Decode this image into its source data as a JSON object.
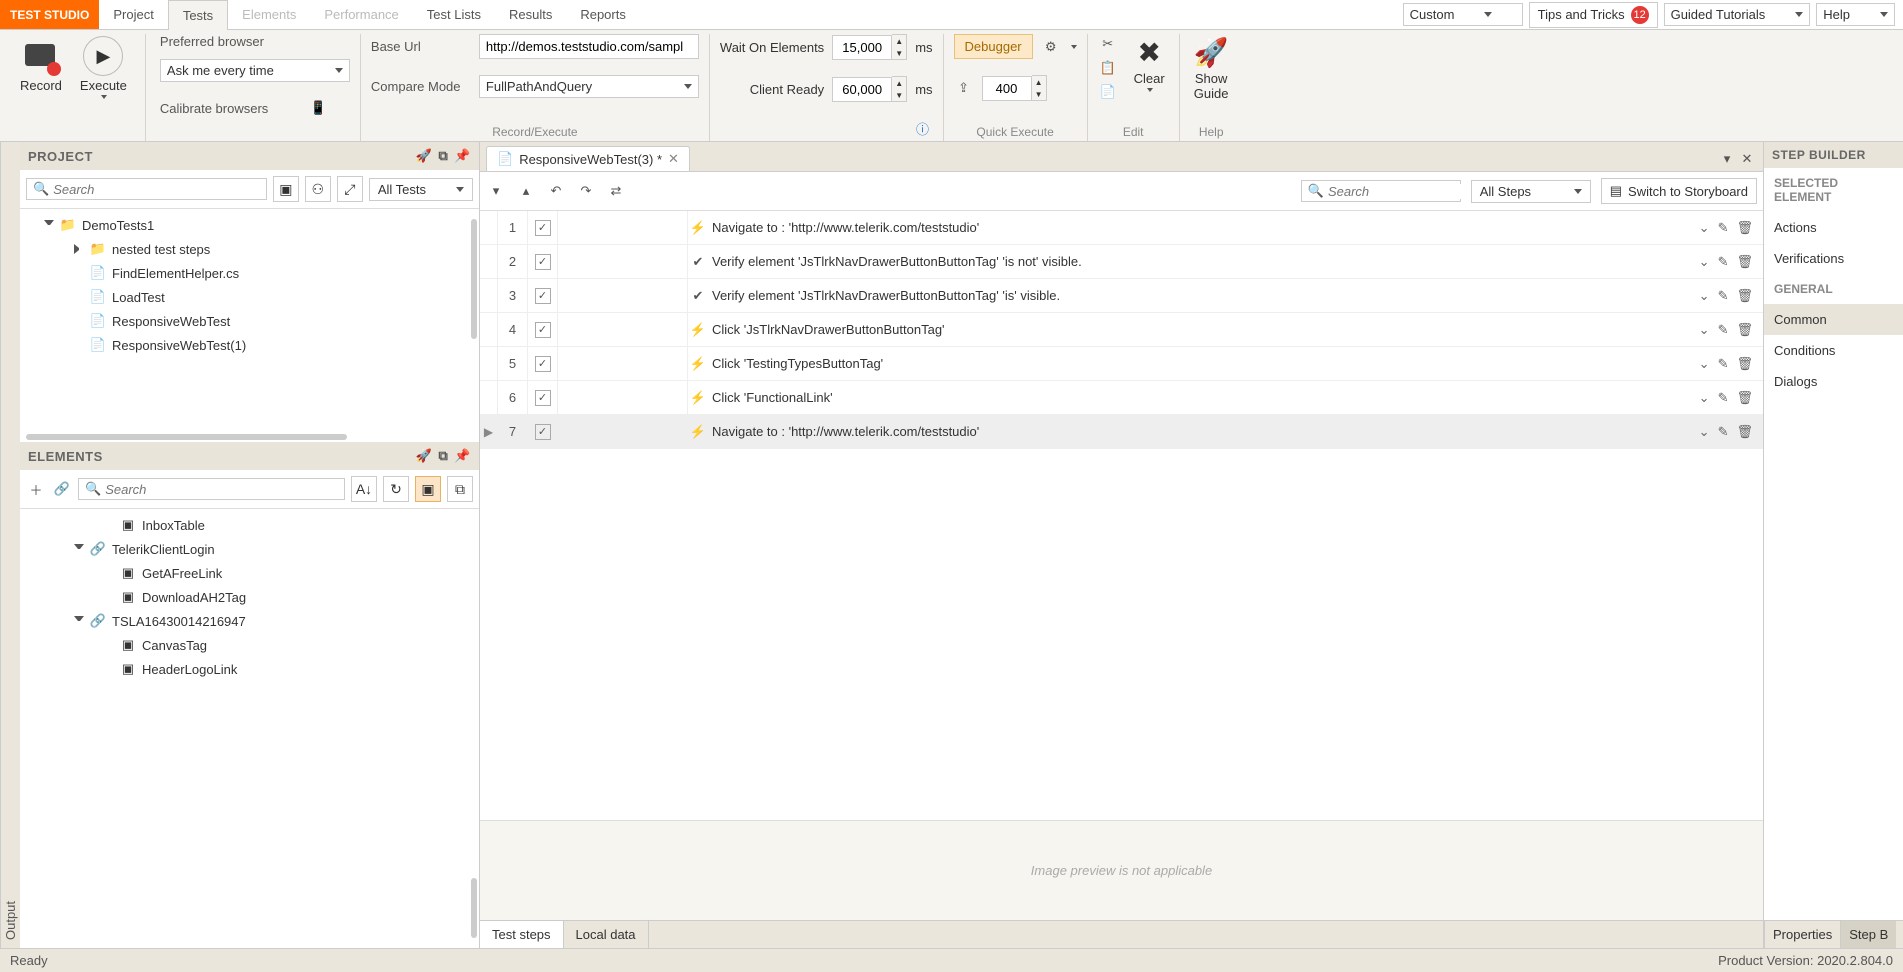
{
  "brand": "TEST STUDIO",
  "menus": [
    "Project",
    "Tests",
    "Elements",
    "Performance",
    "Test Lists",
    "Results",
    "Reports"
  ],
  "menu_active": "Tests",
  "menu_disabled": [
    "Elements",
    "Performance"
  ],
  "layout_combo": "Custom",
  "tips": {
    "label": "Tips and Tricks",
    "count": "12"
  },
  "guided": "Guided Tutorials",
  "help": "Help",
  "ribbon": {
    "record": "Record",
    "execute": "Execute",
    "preferred_browser": "Preferred browser",
    "browser_value": "Ask me every time",
    "calibrate": "Calibrate browsers",
    "base_url": "Base Url",
    "base_url_value": "http://demos.teststudio.com/sampl",
    "compare_mode": "Compare Mode",
    "compare_value": "FullPathAndQuery",
    "record_execute_label": "Record/Execute",
    "wait_on": "Wait On Elements",
    "wait_value": "15,000",
    "client_ready": "Client Ready",
    "client_value": "60,000",
    "ms": "ms",
    "debugger": "Debugger",
    "quick_delay": "400",
    "quick_label": "Quick Execute",
    "clear": "Clear",
    "edit_label": "Edit",
    "show_guide": "Show\nGuide",
    "help_label": "Help"
  },
  "output_tab": "Output",
  "project_panel": {
    "title": "PROJECT",
    "search_ph": "Search",
    "filter": "All Tests",
    "items": [
      {
        "indent": 0,
        "caret": "open",
        "icon": "📁",
        "label": "DemoTests1"
      },
      {
        "indent": 1,
        "caret": "closed",
        "icon": "📁",
        "label": "nested test steps"
      },
      {
        "indent": 1,
        "caret": "",
        "icon": "📄",
        "label": "FindElementHelper.cs"
      },
      {
        "indent": 1,
        "caret": "",
        "icon": "📄",
        "label": "LoadTest"
      },
      {
        "indent": 1,
        "caret": "",
        "icon": "📄",
        "label": "ResponsiveWebTest"
      },
      {
        "indent": 1,
        "caret": "",
        "icon": "📄",
        "label": "ResponsiveWebTest(1)"
      }
    ]
  },
  "elements_panel": {
    "title": "ELEMENTS",
    "search_ph": "Search",
    "items": [
      {
        "indent": 2,
        "caret": "",
        "icon": "▣",
        "label": "InboxTable"
      },
      {
        "indent": 1,
        "caret": "open",
        "icon": "🔗",
        "label": "TelerikClientLogin"
      },
      {
        "indent": 2,
        "caret": "",
        "icon": "▣",
        "label": "GetAFreeLink"
      },
      {
        "indent": 2,
        "caret": "",
        "icon": "▣",
        "label": "DownloadAH2Tag"
      },
      {
        "indent": 1,
        "caret": "open",
        "icon": "🔗",
        "label": "TSLA16430014216947"
      },
      {
        "indent": 2,
        "caret": "",
        "icon": "▣",
        "label": "CanvasTag"
      },
      {
        "indent": 2,
        "caret": "",
        "icon": "▣",
        "label": "HeaderLogoLink"
      }
    ]
  },
  "tab_name": "ResponsiveWebTest(3) *",
  "steps_search_ph": "Search",
  "steps_filter": "All Steps",
  "switch_storyboard": "Switch to Storyboard",
  "steps": [
    {
      "n": "1",
      "icon": "⚡",
      "label": "Navigate to : 'http://www.telerik.com/teststudio'"
    },
    {
      "n": "2",
      "icon": "✔",
      "label": "Verify element 'JsTlrkNavDrawerButtonButtonTag' 'is not' visible."
    },
    {
      "n": "3",
      "icon": "✔",
      "label": "Verify element 'JsTlrkNavDrawerButtonButtonTag' 'is' visible."
    },
    {
      "n": "4",
      "icon": "⚡",
      "label": "Click 'JsTlrkNavDrawerButtonButtonTag'"
    },
    {
      "n": "5",
      "icon": "⚡",
      "label": "Click 'TestingTypesButtonTag'"
    },
    {
      "n": "6",
      "icon": "⚡",
      "label": "Click 'FunctionalLink'"
    },
    {
      "n": "7",
      "icon": "⚡",
      "label": "Navigate to : 'http://www.telerik.com/teststudio'",
      "selected": true
    }
  ],
  "preview_text": "Image preview is not applicable",
  "bottom_tabs": {
    "test_steps": "Test steps",
    "local_data": "Local data"
  },
  "step_builder": {
    "title": "STEP BUILDER",
    "selected_elem": "SELECTED ELEMENT",
    "actions": "Actions",
    "verifications": "Verifications",
    "general": "GENERAL",
    "common": "Common",
    "conditions": "Conditions",
    "dialogs": "Dialogs",
    "properties": "Properties",
    "stepb": "Step B"
  },
  "status": {
    "ready": "Ready",
    "version": "Product Version: 2020.2.804.0"
  }
}
